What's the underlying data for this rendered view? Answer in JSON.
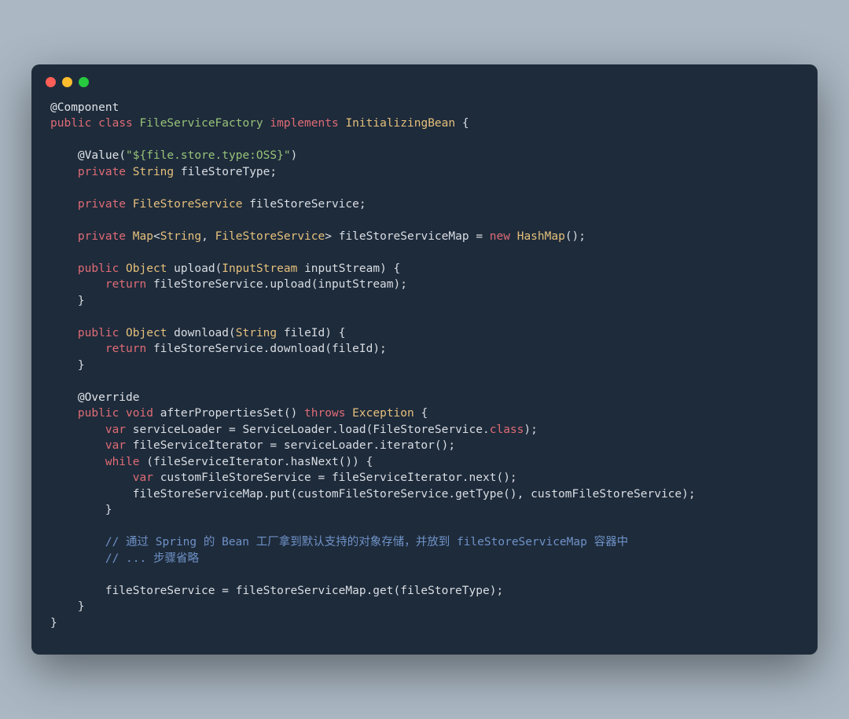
{
  "tokens": [
    {
      "cls": "tok-annot",
      "t": "@Component"
    },
    {
      "cls": "nl",
      "t": "\n"
    },
    {
      "cls": "tok-kw",
      "t": "public"
    },
    {
      "cls": "sp",
      "t": " "
    },
    {
      "cls": "tok-kw",
      "t": "class"
    },
    {
      "cls": "sp",
      "t": " "
    },
    {
      "cls": "tok-class",
      "t": "FileServiceFactory"
    },
    {
      "cls": "sp",
      "t": " "
    },
    {
      "cls": "tok-kw",
      "t": "implements"
    },
    {
      "cls": "sp",
      "t": " "
    },
    {
      "cls": "tok-type",
      "t": "InitializingBean"
    },
    {
      "cls": "sp",
      "t": " "
    },
    {
      "cls": "tok-punct",
      "t": "{"
    },
    {
      "cls": "nl",
      "t": "\n"
    },
    {
      "cls": "nl",
      "t": "\n"
    },
    {
      "cls": "sp",
      "t": "    "
    },
    {
      "cls": "tok-annot",
      "t": "@Value"
    },
    {
      "cls": "tok-punct",
      "t": "("
    },
    {
      "cls": "tok-string",
      "t": "\"${file.store.type:OSS}\""
    },
    {
      "cls": "tok-punct",
      "t": ")"
    },
    {
      "cls": "nl",
      "t": "\n"
    },
    {
      "cls": "sp",
      "t": "    "
    },
    {
      "cls": "tok-kw",
      "t": "private"
    },
    {
      "cls": "sp",
      "t": " "
    },
    {
      "cls": "tok-type",
      "t": "String"
    },
    {
      "cls": "sp",
      "t": " "
    },
    {
      "cls": "tok-var",
      "t": "fileStoreType;"
    },
    {
      "cls": "nl",
      "t": "\n"
    },
    {
      "cls": "nl",
      "t": "\n"
    },
    {
      "cls": "sp",
      "t": "    "
    },
    {
      "cls": "tok-kw",
      "t": "private"
    },
    {
      "cls": "sp",
      "t": " "
    },
    {
      "cls": "tok-type",
      "t": "FileStoreService"
    },
    {
      "cls": "sp",
      "t": " "
    },
    {
      "cls": "tok-var",
      "t": "fileStoreService;"
    },
    {
      "cls": "nl",
      "t": "\n"
    },
    {
      "cls": "nl",
      "t": "\n"
    },
    {
      "cls": "sp",
      "t": "    "
    },
    {
      "cls": "tok-kw",
      "t": "private"
    },
    {
      "cls": "sp",
      "t": " "
    },
    {
      "cls": "tok-type",
      "t": "Map"
    },
    {
      "cls": "tok-punct",
      "t": "<"
    },
    {
      "cls": "tok-type",
      "t": "String"
    },
    {
      "cls": "tok-punct",
      "t": ", "
    },
    {
      "cls": "tok-type",
      "t": "FileStoreService"
    },
    {
      "cls": "tok-punct",
      "t": "> "
    },
    {
      "cls": "tok-var",
      "t": "fileStoreServiceMap = "
    },
    {
      "cls": "tok-new",
      "t": "new"
    },
    {
      "cls": "sp",
      "t": " "
    },
    {
      "cls": "tok-type",
      "t": "HashMap"
    },
    {
      "cls": "tok-punct",
      "t": "();"
    },
    {
      "cls": "nl",
      "t": "\n"
    },
    {
      "cls": "nl",
      "t": "\n"
    },
    {
      "cls": "sp",
      "t": "    "
    },
    {
      "cls": "tok-kw",
      "t": "public"
    },
    {
      "cls": "sp",
      "t": " "
    },
    {
      "cls": "tok-type",
      "t": "Object"
    },
    {
      "cls": "sp",
      "t": " "
    },
    {
      "cls": "tok-method",
      "t": "upload"
    },
    {
      "cls": "tok-punct",
      "t": "("
    },
    {
      "cls": "tok-type",
      "t": "InputStream"
    },
    {
      "cls": "sp",
      "t": " "
    },
    {
      "cls": "tok-var",
      "t": "inputStream"
    },
    {
      "cls": "tok-punct",
      "t": ") {"
    },
    {
      "cls": "nl",
      "t": "\n"
    },
    {
      "cls": "sp",
      "t": "        "
    },
    {
      "cls": "tok-kw",
      "t": "return"
    },
    {
      "cls": "sp",
      "t": " "
    },
    {
      "cls": "tok-var",
      "t": "fileStoreService.upload(inputStream);"
    },
    {
      "cls": "nl",
      "t": "\n"
    },
    {
      "cls": "sp",
      "t": "    "
    },
    {
      "cls": "tok-punct",
      "t": "}"
    },
    {
      "cls": "nl",
      "t": "\n"
    },
    {
      "cls": "nl",
      "t": "\n"
    },
    {
      "cls": "sp",
      "t": "    "
    },
    {
      "cls": "tok-kw",
      "t": "public"
    },
    {
      "cls": "sp",
      "t": " "
    },
    {
      "cls": "tok-type",
      "t": "Object"
    },
    {
      "cls": "sp",
      "t": " "
    },
    {
      "cls": "tok-method",
      "t": "download"
    },
    {
      "cls": "tok-punct",
      "t": "("
    },
    {
      "cls": "tok-type",
      "t": "String"
    },
    {
      "cls": "sp",
      "t": " "
    },
    {
      "cls": "tok-var",
      "t": "fileId"
    },
    {
      "cls": "tok-punct",
      "t": ") {"
    },
    {
      "cls": "nl",
      "t": "\n"
    },
    {
      "cls": "sp",
      "t": "        "
    },
    {
      "cls": "tok-kw",
      "t": "return"
    },
    {
      "cls": "sp",
      "t": " "
    },
    {
      "cls": "tok-var",
      "t": "fileStoreService.download(fileId);"
    },
    {
      "cls": "nl",
      "t": "\n"
    },
    {
      "cls": "sp",
      "t": "    "
    },
    {
      "cls": "tok-punct",
      "t": "}"
    },
    {
      "cls": "nl",
      "t": "\n"
    },
    {
      "cls": "nl",
      "t": "\n"
    },
    {
      "cls": "sp",
      "t": "    "
    },
    {
      "cls": "tok-annot",
      "t": "@Override"
    },
    {
      "cls": "nl",
      "t": "\n"
    },
    {
      "cls": "sp",
      "t": "    "
    },
    {
      "cls": "tok-kw",
      "t": "public"
    },
    {
      "cls": "sp",
      "t": " "
    },
    {
      "cls": "tok-kw",
      "t": "void"
    },
    {
      "cls": "sp",
      "t": " "
    },
    {
      "cls": "tok-method",
      "t": "afterPropertiesSet"
    },
    {
      "cls": "tok-punct",
      "t": "() "
    },
    {
      "cls": "tok-kw",
      "t": "throws"
    },
    {
      "cls": "sp",
      "t": " "
    },
    {
      "cls": "tok-type",
      "t": "Exception"
    },
    {
      "cls": "sp",
      "t": " "
    },
    {
      "cls": "tok-punct",
      "t": "{"
    },
    {
      "cls": "nl",
      "t": "\n"
    },
    {
      "cls": "sp",
      "t": "        "
    },
    {
      "cls": "tok-kw",
      "t": "var"
    },
    {
      "cls": "sp",
      "t": " "
    },
    {
      "cls": "tok-var",
      "t": "serviceLoader = ServiceLoader.load(FileStoreService."
    },
    {
      "cls": "tok-prop",
      "t": "class"
    },
    {
      "cls": "tok-var",
      "t": ");"
    },
    {
      "cls": "nl",
      "t": "\n"
    },
    {
      "cls": "sp",
      "t": "        "
    },
    {
      "cls": "tok-kw",
      "t": "var"
    },
    {
      "cls": "sp",
      "t": " "
    },
    {
      "cls": "tok-var",
      "t": "fileServiceIterator = serviceLoader.iterator();"
    },
    {
      "cls": "nl",
      "t": "\n"
    },
    {
      "cls": "sp",
      "t": "        "
    },
    {
      "cls": "tok-kw",
      "t": "while"
    },
    {
      "cls": "sp",
      "t": " "
    },
    {
      "cls": "tok-punct",
      "t": "("
    },
    {
      "cls": "tok-var",
      "t": "fileServiceIterator.hasNext()"
    },
    {
      "cls": "tok-punct",
      "t": ") {"
    },
    {
      "cls": "nl",
      "t": "\n"
    },
    {
      "cls": "sp",
      "t": "            "
    },
    {
      "cls": "tok-kw",
      "t": "var"
    },
    {
      "cls": "sp",
      "t": " "
    },
    {
      "cls": "tok-var",
      "t": "customFileStoreService = fileServiceIterator.next();"
    },
    {
      "cls": "nl",
      "t": "\n"
    },
    {
      "cls": "sp",
      "t": "            "
    },
    {
      "cls": "tok-var",
      "t": "fileStoreServiceMap.put(customFileStoreService.getType(), customFileStoreService);"
    },
    {
      "cls": "nl",
      "t": "\n"
    },
    {
      "cls": "sp",
      "t": "        "
    },
    {
      "cls": "tok-punct",
      "t": "}"
    },
    {
      "cls": "nl",
      "t": "\n"
    },
    {
      "cls": "nl",
      "t": "\n"
    },
    {
      "cls": "sp",
      "t": "        "
    },
    {
      "cls": "tok-comment",
      "t": "// 通过 Spring 的 Bean 工厂拿到默认支持的对象存储，并放到 fileStoreServiceMap 容器中"
    },
    {
      "cls": "nl",
      "t": "\n"
    },
    {
      "cls": "sp",
      "t": "        "
    },
    {
      "cls": "tok-comment",
      "t": "// ... 步骤省略"
    },
    {
      "cls": "nl",
      "t": "\n"
    },
    {
      "cls": "nl",
      "t": "\n"
    },
    {
      "cls": "sp",
      "t": "        "
    },
    {
      "cls": "tok-var",
      "t": "fileStoreService = fileStoreServiceMap.get(fileStoreType);"
    },
    {
      "cls": "nl",
      "t": "\n"
    },
    {
      "cls": "sp",
      "t": "    "
    },
    {
      "cls": "tok-punct",
      "t": "}"
    },
    {
      "cls": "nl",
      "t": "\n"
    },
    {
      "cls": "tok-punct",
      "t": "}"
    }
  ]
}
